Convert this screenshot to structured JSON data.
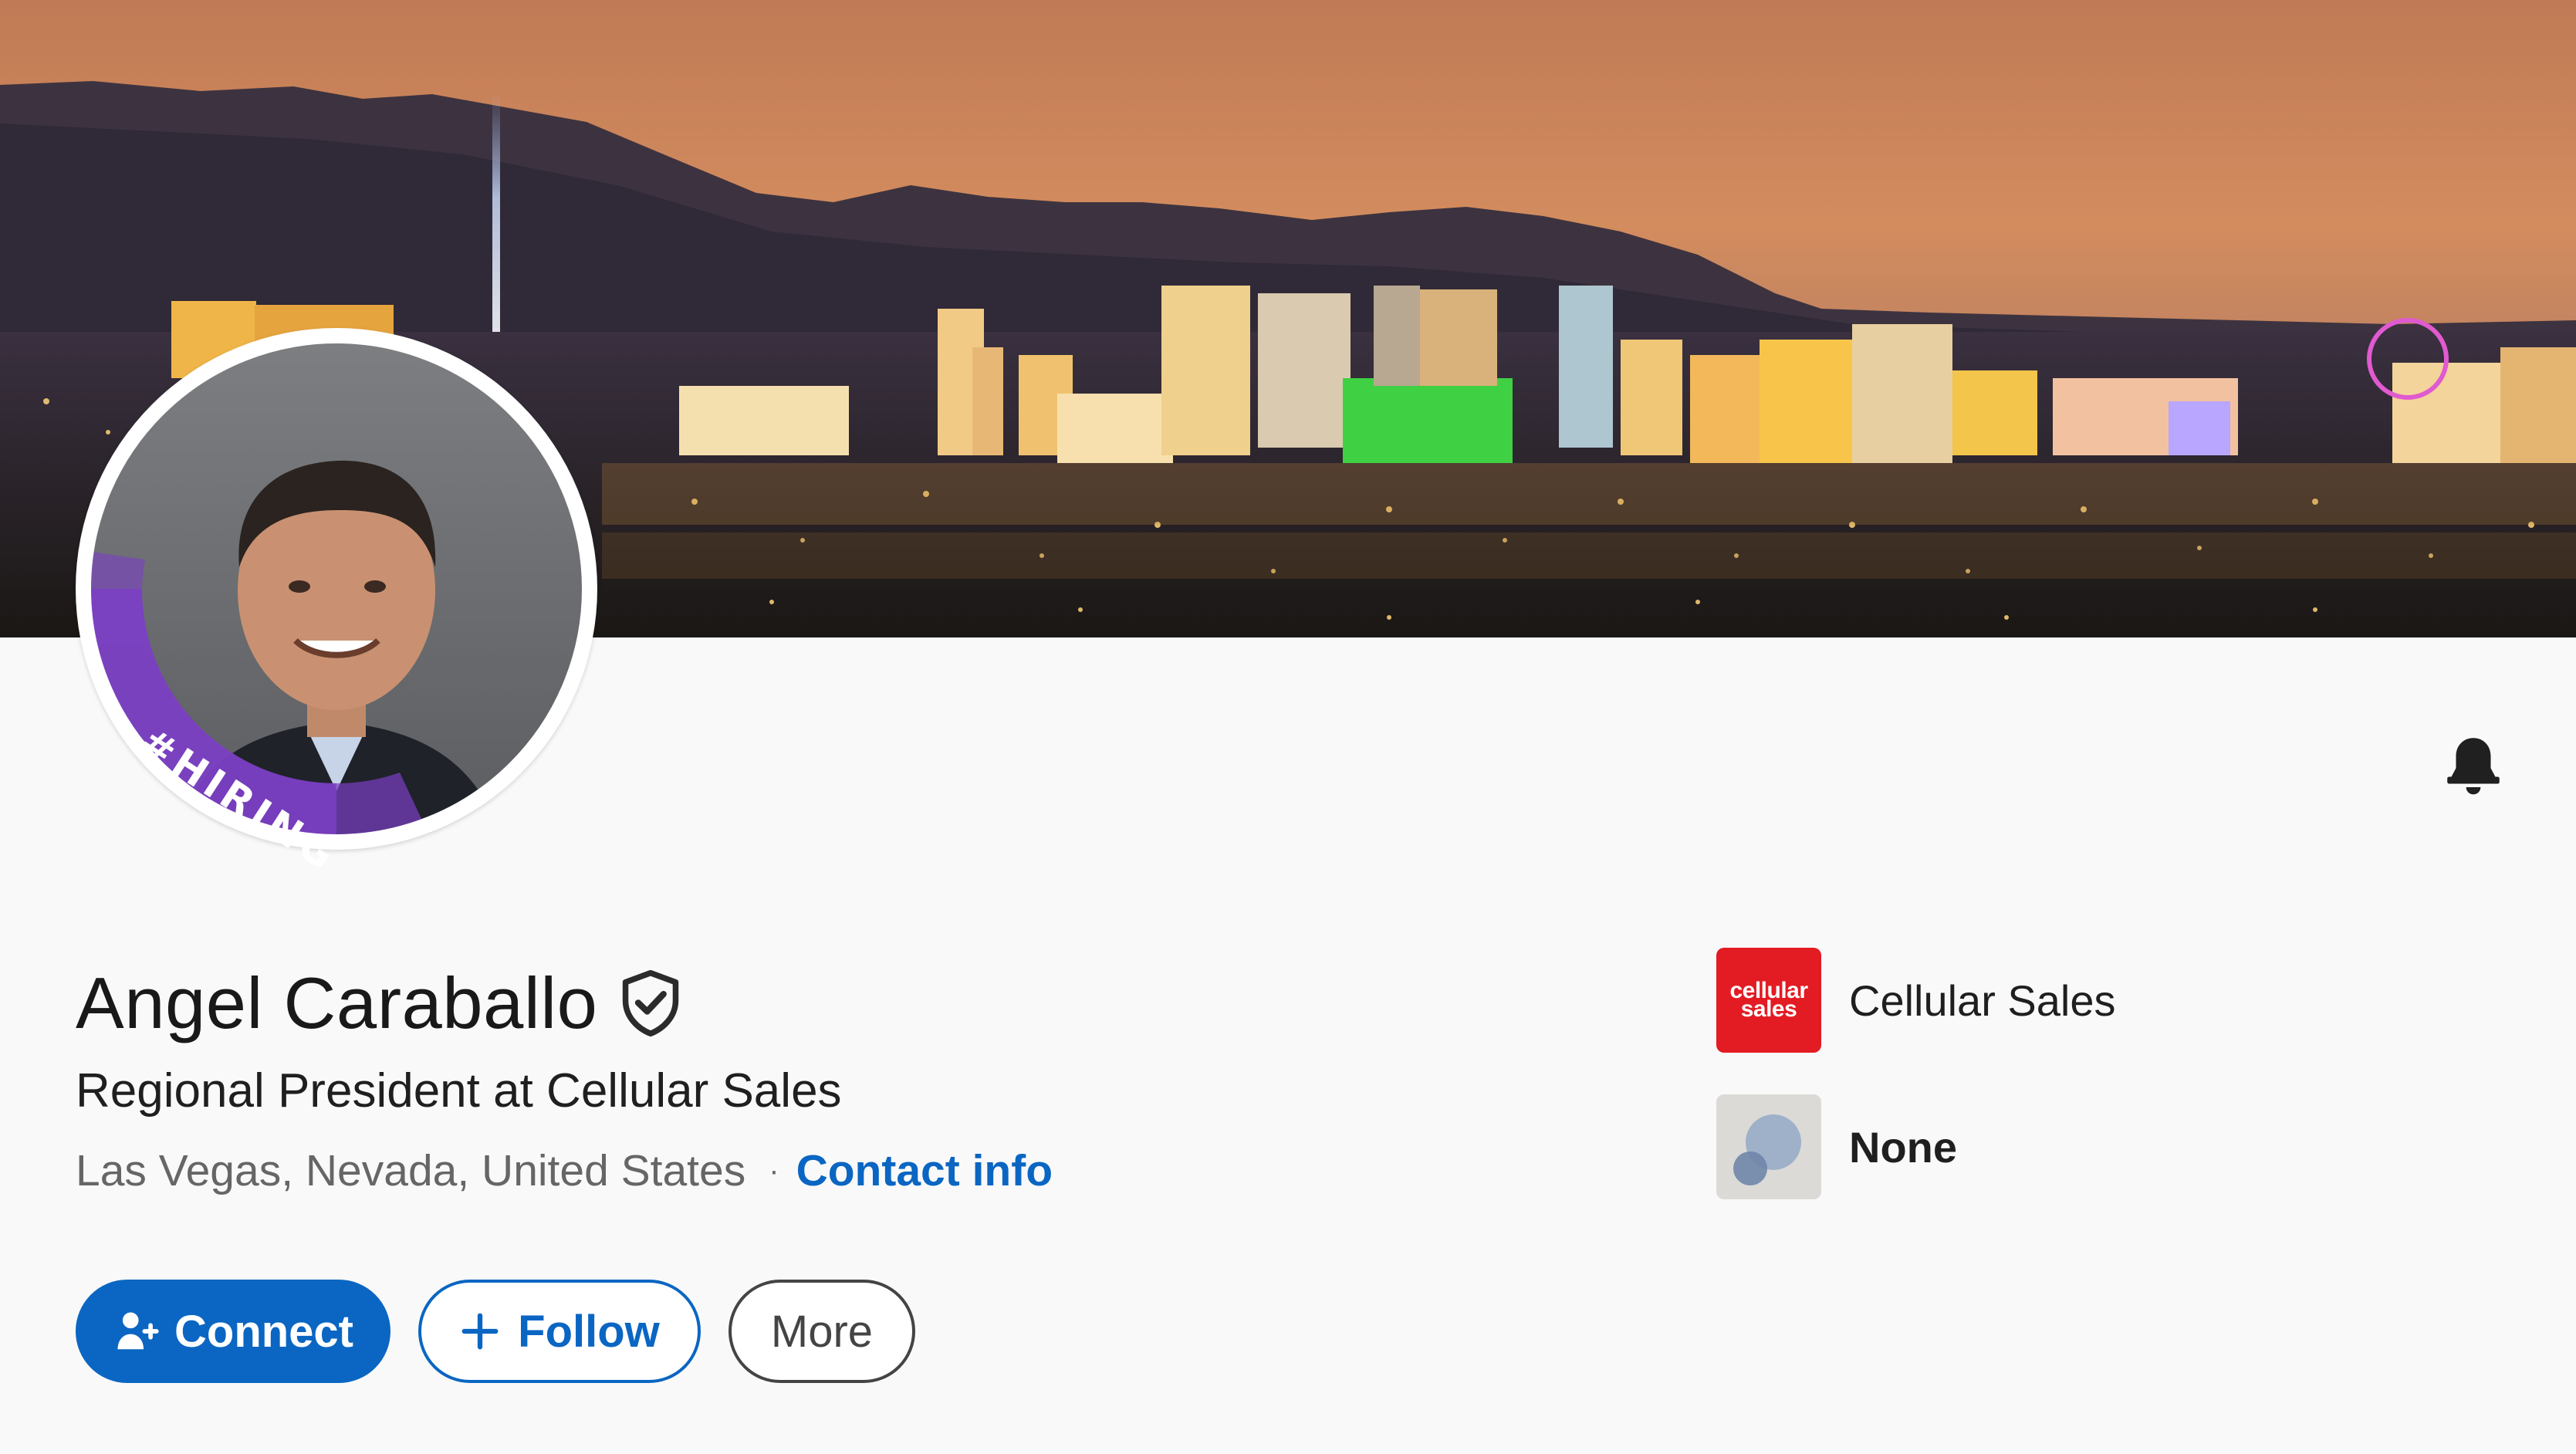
{
  "profile": {
    "name": "Angel Caraballo",
    "headline": "Regional President at Cellular Sales",
    "location": "Las Vegas, Nevada, United States",
    "separator": "·",
    "contact_info_label": "Contact info",
    "hiring_badge": "#HIRING"
  },
  "actions": {
    "connect_label": "Connect",
    "follow_label": "Follow",
    "more_label": "More"
  },
  "companies": [
    {
      "name": "Cellular Sales",
      "logo_text_line1": "cellular",
      "logo_text_line2": "sales"
    },
    {
      "name": "None"
    }
  ],
  "icons": {
    "verified": "shield-check-icon",
    "bell": "bell-icon",
    "connect": "person-add-icon",
    "follow": "plus-icon"
  },
  "colors": {
    "brand_blue": "#0a66c2",
    "hiring_purple": "#7b3fc4",
    "cellular_red": "#e31b23",
    "text_primary": "#191919",
    "text_secondary": "#666666"
  }
}
